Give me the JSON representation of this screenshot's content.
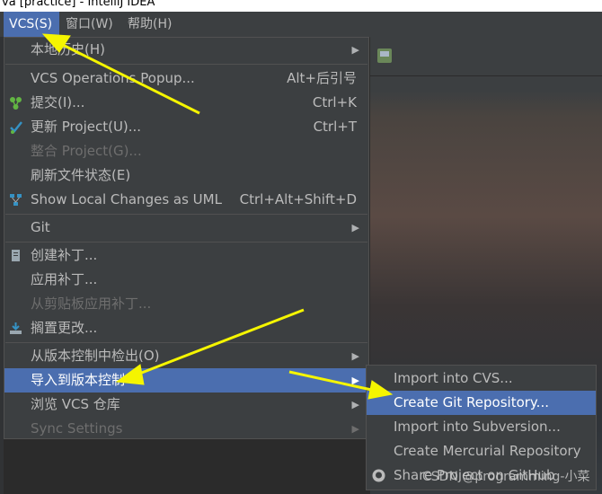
{
  "window": {
    "title": "va [practice] - IntelliJ IDEA"
  },
  "menubar": [
    {
      "label": "VCS(S)",
      "active": true
    },
    {
      "label": "窗口(W)"
    },
    {
      "label": "帮助(H)"
    }
  ],
  "vcs_menu": {
    "local_history": "本地历史(H)",
    "operations_popup": {
      "label": "VCS Operations Popup...",
      "shortcut": "Alt+后引号"
    },
    "commit": {
      "label": "提交(I)...",
      "shortcut": "Ctrl+K"
    },
    "update_project": {
      "label": "更新 Project(U)...",
      "shortcut": "Ctrl+T"
    },
    "integrate_project": "整合 Project(G)...",
    "refresh_file_status": "刷新文件状态(E)",
    "show_local_changes": {
      "label": "Show Local Changes as UML",
      "shortcut": "Ctrl+Alt+Shift+D"
    },
    "git": "Git",
    "create_patch": "创建补丁...",
    "apply_patch": "应用补丁...",
    "apply_patch_clipboard": "从剪贴板应用补丁...",
    "shelve_changes": "搁置更改...",
    "checkout_from_vcs": "从版本控制中检出(O)",
    "import_into_vcs": "导入到版本控制",
    "browse_vcs_repo": "浏览 VCS 仓库",
    "sync_settings": "Sync Settings"
  },
  "import_submenu": {
    "import_cvs": "Import into CVS...",
    "create_git_repo": "Create Git Repository...",
    "import_subversion": "Import into Subversion...",
    "create_mercurial": "Create Mercurial Repository",
    "share_github": "Share Project on GitHub"
  },
  "watermark": "CSDN @programming-小菜",
  "colors": {
    "selection": "#4b6eaf",
    "menu_bg": "#3c3f41",
    "arrow": "#f5f500"
  }
}
